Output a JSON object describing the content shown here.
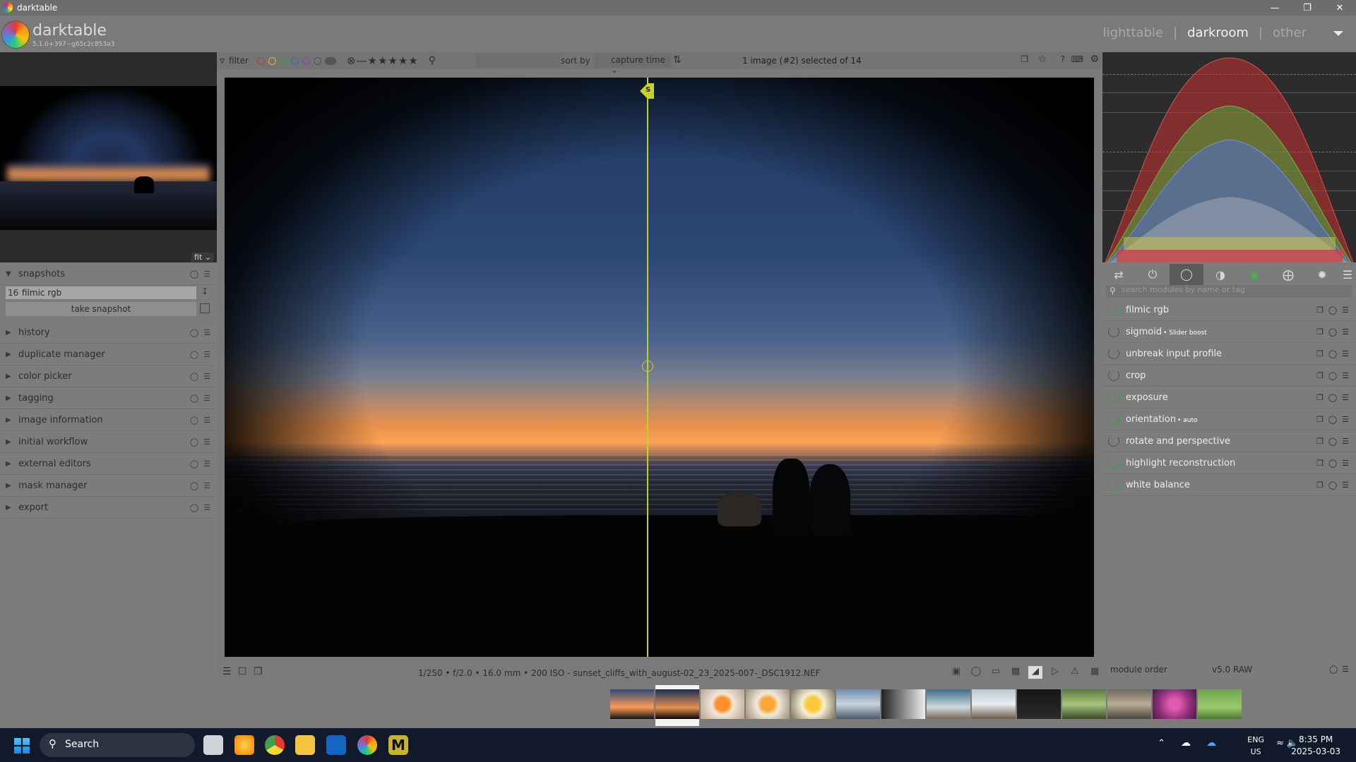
{
  "window": {
    "title": "darktable"
  },
  "header": {
    "brand": "darktable",
    "version": "5.1.0+397~g65c2c853a3",
    "views": [
      "lighttable",
      "darkroom",
      "other"
    ],
    "active_view": "darkroom"
  },
  "filter_bar": {
    "filter_label": "filter",
    "sort_label": "sort by",
    "sort_value": "capture time",
    "selection_info": "1 image (#2) selected of 14",
    "color_labels": [
      "#c0392b",
      "#d4c21a",
      "#2e9e3b",
      "#2f6fb5",
      "#8e44ad"
    ]
  },
  "left_panel": {
    "navigation_zoom": "fit",
    "snapshots": {
      "title": "snapshots",
      "items": [
        {
          "number": "16",
          "label": "filmic rgb"
        }
      ],
      "take_button": "take snapshot"
    },
    "modules": [
      "history",
      "duplicate manager",
      "color picker",
      "tagging",
      "image information",
      "initial workflow",
      "external editors",
      "mask manager",
      "export"
    ]
  },
  "image": {
    "snapshot_marker": "S",
    "exif": "1/250 • f/2.0 • 16.0 mm • 200 ISO - sunset_cliffs_with_august-02_23_2025-007-_DSC1912.NEF"
  },
  "right_panel": {
    "search_placeholder": "search modules by name or tag",
    "modules": [
      {
        "label": "filmic rgb",
        "sub": "",
        "enabled": true
      },
      {
        "label": "sigmoid",
        "sub": "• Slider boost",
        "enabled": false
      },
      {
        "label": "unbreak input profile",
        "sub": "",
        "enabled": false
      },
      {
        "label": "crop",
        "sub": "",
        "enabled": false
      },
      {
        "label": "exposure",
        "sub": "",
        "enabled": true
      },
      {
        "label": "orientation",
        "sub": "• auto",
        "enabled": true
      },
      {
        "label": "rotate and perspective",
        "sub": "",
        "enabled": false
      },
      {
        "label": "highlight reconstruction",
        "sub": "",
        "enabled": true
      },
      {
        "label": "white balance",
        "sub": "",
        "enabled": true
      }
    ],
    "module_order_label": "module order",
    "module_order_value": "v5.0 RAW"
  },
  "taskbar": {
    "search_label": "Search",
    "lang_1": "ENG",
    "lang_2": "US",
    "time": "8:35 PM",
    "date": "2025-03-03"
  }
}
